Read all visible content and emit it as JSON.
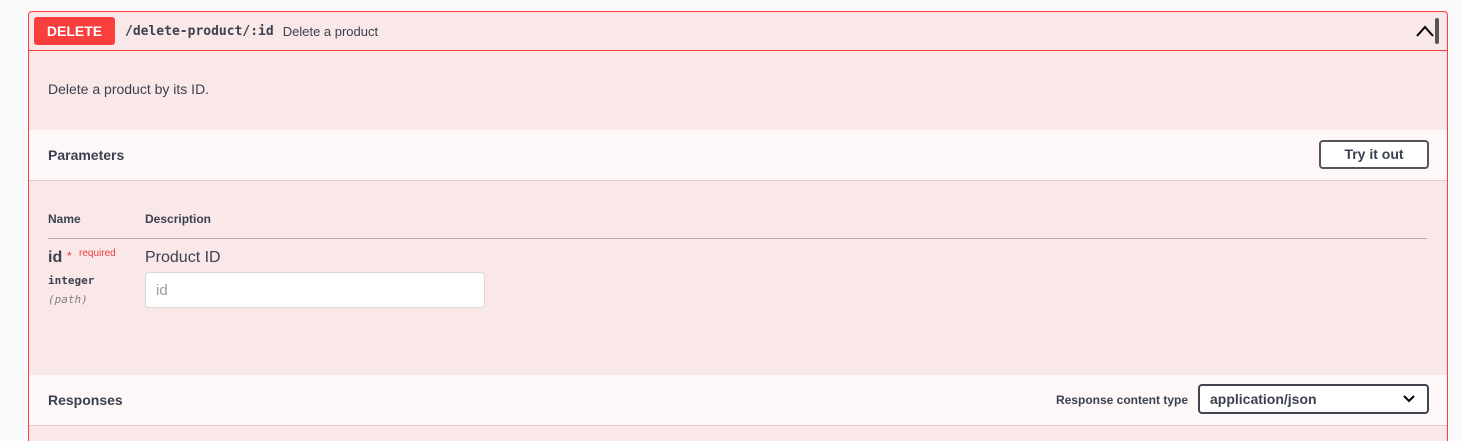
{
  "operation": {
    "method": "DELETE",
    "path": "/delete-product/:id",
    "summary": "Delete a product",
    "description": "Delete a product by its ID.",
    "method_color": "#f93e3e",
    "background_color": "#fae7e7"
  },
  "parameters": {
    "title": "Parameters",
    "try_it_out_label": "Try it out",
    "columns": {
      "name": "Name",
      "description": "Description"
    },
    "items": [
      {
        "name": "id",
        "required_marker": "*",
        "required_label": "required",
        "type": "integer",
        "in": "(path)",
        "description": "Product ID",
        "placeholder": "id",
        "value": ""
      }
    ]
  },
  "responses": {
    "title": "Responses",
    "content_type_label": "Response content type",
    "content_type_value": "application/json"
  },
  "icons": {
    "collapse": "chevron-up-icon",
    "select": "chevron-down-icon"
  }
}
